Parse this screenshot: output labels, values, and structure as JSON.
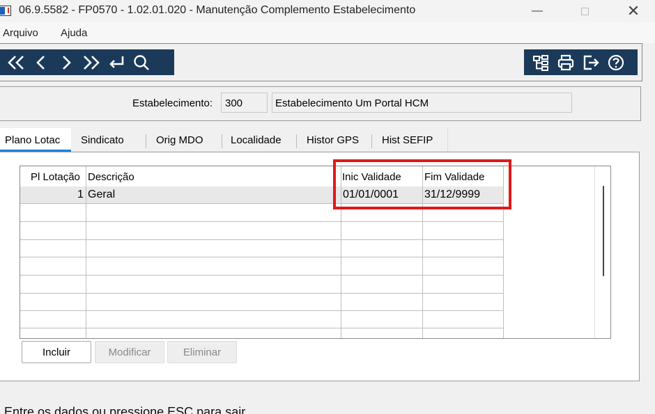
{
  "window": {
    "title": "06.9.5582 - FP0570 - 1.02.01.020 - Manutenção Complemento Estabelecimento",
    "minimize_glyph": "—",
    "close_glyph": "✕"
  },
  "menu": {
    "items": [
      "Arquivo",
      "Ajuda"
    ]
  },
  "toolbar": {
    "left_icons": [
      "first-record-icon",
      "previous-record-icon",
      "next-record-icon",
      "last-record-icon",
      "goto-icon",
      "search-icon"
    ],
    "right_icons": [
      "tree-structure-icon",
      "print-icon",
      "exit-icon",
      "help-icon"
    ],
    "accent_color": "#1b3a5a"
  },
  "establishment": {
    "label": "Estabelecimento:",
    "code": "300",
    "name": "Estabelecimento Um Portal HCM"
  },
  "tabs": [
    {
      "label": "Plano Lotac",
      "active": true
    },
    {
      "label": "Sindicato",
      "active": false
    },
    {
      "label": "Orig MDO",
      "active": false
    },
    {
      "label": "Localidade",
      "active": false
    },
    {
      "label": "Histor GPS",
      "active": false
    },
    {
      "label": "Hist SEFIP",
      "active": false
    }
  ],
  "grid": {
    "columns": [
      "Pl Lotação",
      "Descrição",
      "Inic Validade",
      "Fim Validade"
    ],
    "rows": [
      {
        "pl_lotacao": "1",
        "descricao": "Geral",
        "inic_validade": "01/01/0001",
        "fim_validade": "31/12/9999"
      }
    ]
  },
  "actions": {
    "incluir": "Incluir",
    "modificar": "Modificar",
    "eliminar": "Eliminar"
  },
  "highlight_color": "#e01919",
  "status": {
    "text": "Entre os dados ou pressione ESC para sair"
  }
}
